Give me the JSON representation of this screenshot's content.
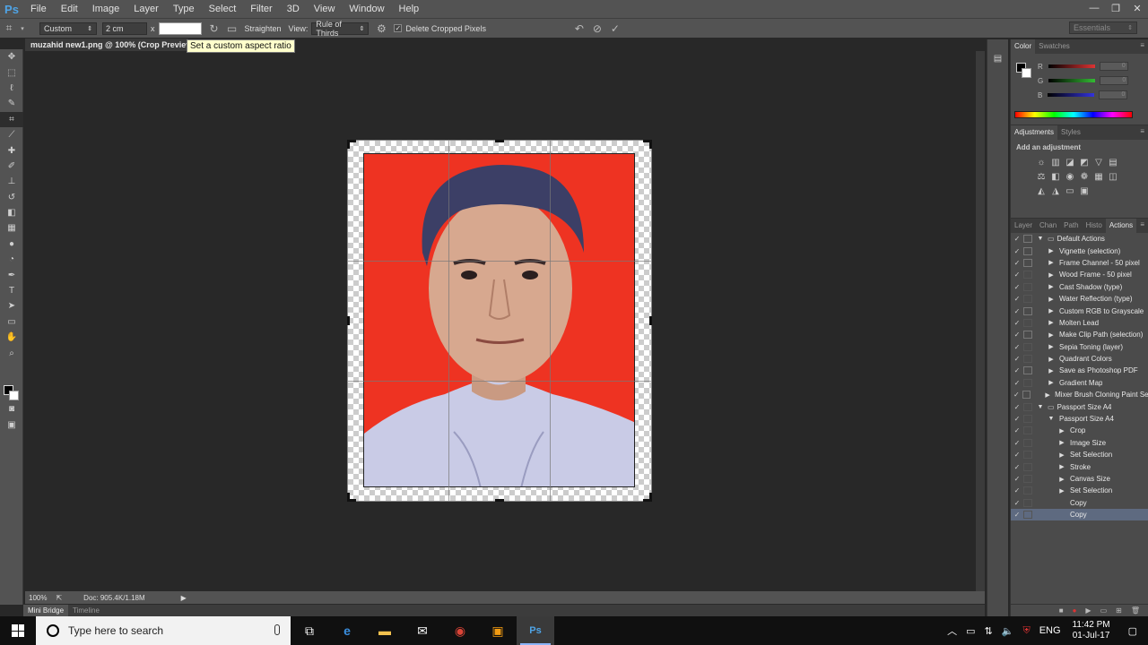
{
  "app": {
    "logo": "Ps"
  },
  "menu": [
    "File",
    "Edit",
    "Image",
    "Layer",
    "Type",
    "Select",
    "Filter",
    "3D",
    "View",
    "Window",
    "Help"
  ],
  "window_controls": [
    "—",
    "❐",
    "✕"
  ],
  "options_bar": {
    "preset": "Custom",
    "width_value": "2 cm",
    "x_separator": "x",
    "height_value": "",
    "straighten_label": "Straighten",
    "view_label": "View:",
    "view_value": "Rule of Thirds",
    "delete_cropped_label": "Delete Cropped Pixels",
    "workspace": "Essentials"
  },
  "tooltip": "Set a custom aspect ratio",
  "document": {
    "tab_title": "muzahid new1.png @ 100% (Crop Preview, RGB/8)",
    "zoom": "100%",
    "doc_info": "Doc: 905.4K/1.18M"
  },
  "bottom_tabs": [
    "Mini Bridge",
    "Timeline"
  ],
  "color_panel": {
    "tabs": [
      "Color",
      "Swatches"
    ],
    "channels": [
      {
        "label": "R",
        "value": "0",
        "color": "#d33"
      },
      {
        "label": "G",
        "value": "0",
        "color": "#3b3"
      },
      {
        "label": "B",
        "value": "0",
        "color": "#33d"
      }
    ]
  },
  "adjustments_panel": {
    "tabs": [
      "Adjustments",
      "Styles"
    ],
    "title": "Add an adjustment"
  },
  "actions_panel": {
    "tabs": [
      "Layer",
      "Chan",
      "Path",
      "Histo",
      "Actions"
    ],
    "items": [
      {
        "label": "Default Actions",
        "level": 0,
        "toggle": "▼",
        "folder": true,
        "dialog": true
      },
      {
        "label": "Vignette (selection)",
        "level": 1,
        "toggle": "▶",
        "dialog": true
      },
      {
        "label": "Frame Channel - 50 pixel",
        "level": 1,
        "toggle": "▶",
        "dialog": true
      },
      {
        "label": "Wood Frame - 50 pixel",
        "level": 1,
        "toggle": "▶",
        "dialog": false
      },
      {
        "label": "Cast Shadow (type)",
        "level": 1,
        "toggle": "▶",
        "dialog": false
      },
      {
        "label": "Water Reflection (type)",
        "level": 1,
        "toggle": "▶",
        "dialog": false
      },
      {
        "label": "Custom RGB to Grayscale",
        "level": 1,
        "toggle": "▶",
        "dialog": true
      },
      {
        "label": "Molten Lead",
        "level": 1,
        "toggle": "▶",
        "dialog": false
      },
      {
        "label": "Make Clip Path (selection)",
        "level": 1,
        "toggle": "▶",
        "dialog": true
      },
      {
        "label": "Sepia Toning (layer)",
        "level": 1,
        "toggle": "▶",
        "dialog": false
      },
      {
        "label": "Quadrant Colors",
        "level": 1,
        "toggle": "▶",
        "dialog": false
      },
      {
        "label": "Save as Photoshop PDF",
        "level": 1,
        "toggle": "▶",
        "dialog": true
      },
      {
        "label": "Gradient Map",
        "level": 1,
        "toggle": "▶",
        "dialog": false
      },
      {
        "label": "Mixer Brush Cloning Paint Setup",
        "level": 1,
        "toggle": "▶",
        "dialog": true
      },
      {
        "label": "Passport Size A4",
        "level": 0,
        "toggle": "▼",
        "folder": true,
        "dialog": false
      },
      {
        "label": "Passport Size A4",
        "level": 1,
        "toggle": "▼",
        "dialog": false
      },
      {
        "label": "Crop",
        "level": 2,
        "toggle": "▶",
        "dialog": false
      },
      {
        "label": "Image Size",
        "level": 2,
        "toggle": "▶",
        "dialog": false
      },
      {
        "label": "Set Selection",
        "level": 2,
        "toggle": "▶",
        "dialog": false
      },
      {
        "label": "Stroke",
        "level": 2,
        "toggle": "▶",
        "dialog": false
      },
      {
        "label": "Canvas Size",
        "level": 2,
        "toggle": "▶",
        "dialog": false
      },
      {
        "label": "Set Selection",
        "level": 2,
        "toggle": "▶",
        "dialog": false
      },
      {
        "label": "Copy",
        "level": 2,
        "toggle": "",
        "dialog": false
      },
      {
        "label": "Copy",
        "level": 2,
        "toggle": "",
        "dialog": false,
        "selected": true
      }
    ]
  },
  "taskbar": {
    "search_placeholder": "Type here to search",
    "language": "ENG",
    "time": "11:42 PM",
    "date": "01-Jul-17"
  }
}
